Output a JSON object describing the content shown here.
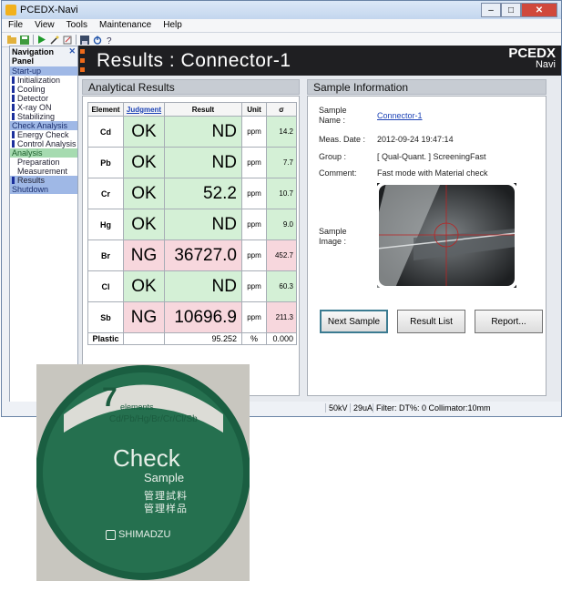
{
  "window": {
    "title": "PCEDX-Navi",
    "min": "–",
    "max": "□",
    "close": "✕"
  },
  "menu": [
    "File",
    "View",
    "Tools",
    "Maintenance",
    "Help"
  ],
  "toolbar_icons": [
    "open-folder-icon",
    "save-icon",
    "play-icon",
    "wand-icon",
    "edit-icon",
    "disk-icon",
    "power-icon",
    "help-icon"
  ],
  "nav": {
    "header": "Navigation Panel",
    "close": "✕",
    "groups": {
      "startup": "Start-up",
      "check": "Check Analysis",
      "analysis": "Analysis",
      "shutdown": "Shutdown"
    },
    "items": {
      "initialization": "Initialization",
      "cooling": "Cooling",
      "detector": "Detector",
      "xray": "X-ray ON",
      "stabilizing": "Stabilizing",
      "energy": "Energy Check",
      "control": "Control Analysis",
      "preparation": "Preparation",
      "measurement": "Measurement",
      "results": "Results"
    }
  },
  "banner": {
    "title": "Results : Connector-1",
    "brand1": "PCEDX",
    "brand2": "Navi"
  },
  "analytical": {
    "title": "Analytical Results",
    "headers": {
      "element": "Element",
      "judgment": "Judgment",
      "result": "Result",
      "unit": "Unit",
      "sigma": "σ"
    },
    "rows": [
      {
        "element": "Cd",
        "judgment": "OK",
        "result": "ND",
        "unit": "ppm",
        "sigma": "14.2"
      },
      {
        "element": "Pb",
        "judgment": "OK",
        "result": "ND",
        "unit": "ppm",
        "sigma": "7.7"
      },
      {
        "element": "Cr",
        "judgment": "OK",
        "result": "52.2",
        "unit": "ppm",
        "sigma": "10.7"
      },
      {
        "element": "Hg",
        "judgment": "OK",
        "result": "ND",
        "unit": "ppm",
        "sigma": "9.0"
      },
      {
        "element": "Br",
        "judgment": "NG",
        "result": "36727.0",
        "unit": "ppm",
        "sigma": "452.7"
      },
      {
        "element": "Cl",
        "judgment": "OK",
        "result": "ND",
        "unit": "ppm",
        "sigma": "60.3"
      },
      {
        "element": "Sb",
        "judgment": "NG",
        "result": "10696.9",
        "unit": "ppm",
        "sigma": "211.3"
      }
    ],
    "plastic": {
      "element": "Plastic",
      "result": "95.252",
      "unit": "%",
      "sigma": "0.000"
    }
  },
  "sample_info": {
    "title": "Sample Information",
    "name_label_1": "Sample",
    "name_label_2": "Name :",
    "name_value": "Connector-1",
    "date_label": "Meas. Date :",
    "date_value": "2012-09-24 19:47:14",
    "group_label": "Group :",
    "group_value": "[ Qual-Quant. ] ScreeningFast",
    "comment_label": "Comment:",
    "comment_value": "Fast mode with Material check",
    "image_label_1": "Sample",
    "image_label_2": "Image :"
  },
  "buttons": {
    "next": "Next Sample",
    "list": "Result List",
    "report": "Report..."
  },
  "status": {
    "kv": "50kV",
    "ua": "29uA",
    "filter": "Filter: DT%: 0 Collimator:10mm"
  },
  "photo": {
    "count": "7",
    "count_label": "elements",
    "elements_line": "Cd/Pb/Hg/Br/Cr/Cl/Sb",
    "check": "Check",
    "sample": "Sample",
    "jp1": "管理試料",
    "jp2": "管理样品",
    "logo": "SHIMADZU"
  }
}
